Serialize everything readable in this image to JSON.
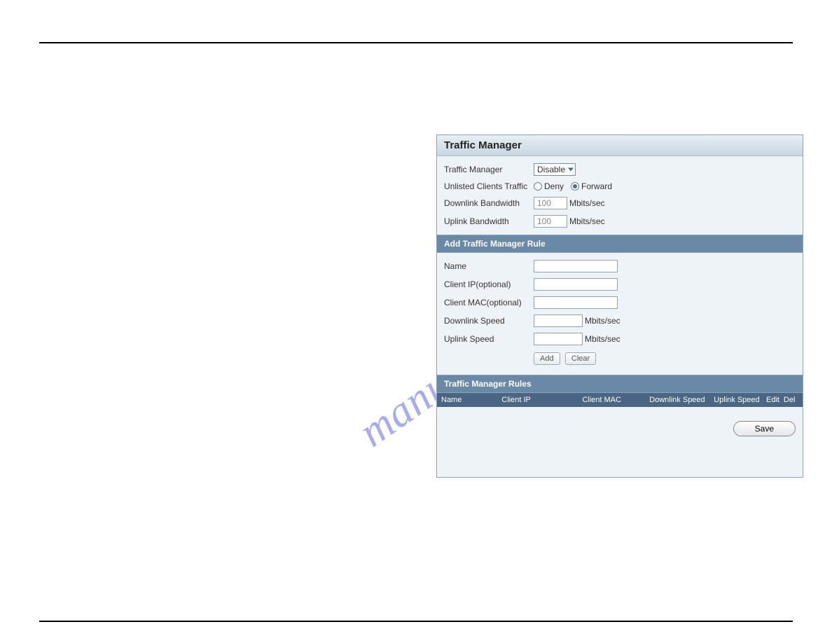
{
  "watermark": "manualshive.com",
  "panel": {
    "title": "Traffic Manager",
    "settings": {
      "traffic_manager_label": "Traffic Manager",
      "traffic_manager_value": "Disable",
      "unlisted_label": "Unlisted Clients Traffic",
      "unlisted_deny": "Deny",
      "unlisted_forward": "Forward",
      "unlisted_selected": "forward",
      "downlink_label": "Downlink Bandwidth",
      "downlink_value": "100",
      "uplink_label": "Uplink Bandwidth",
      "uplink_value": "100",
      "bw_unit": "Mbits/sec"
    },
    "add_rule": {
      "header": "Add Traffic Manager Rule",
      "name_label": "Name",
      "client_ip_label": "Client IP(optional)",
      "client_mac_label": "Client MAC(optional)",
      "downlink_speed_label": "Downlink Speed",
      "uplink_speed_label": "Uplink Speed",
      "speed_unit": "Mbits/sec",
      "add_btn": "Add",
      "clear_btn": "Clear"
    },
    "rules": {
      "header": "Traffic Manager Rules",
      "columns": {
        "name": "Name",
        "client_ip": "Client IP",
        "client_mac": "Client MAC",
        "downlink": "Downlink Speed",
        "uplink": "Uplink Speed",
        "edit": "Edit",
        "del": "Del"
      }
    },
    "save_btn": "Save"
  }
}
